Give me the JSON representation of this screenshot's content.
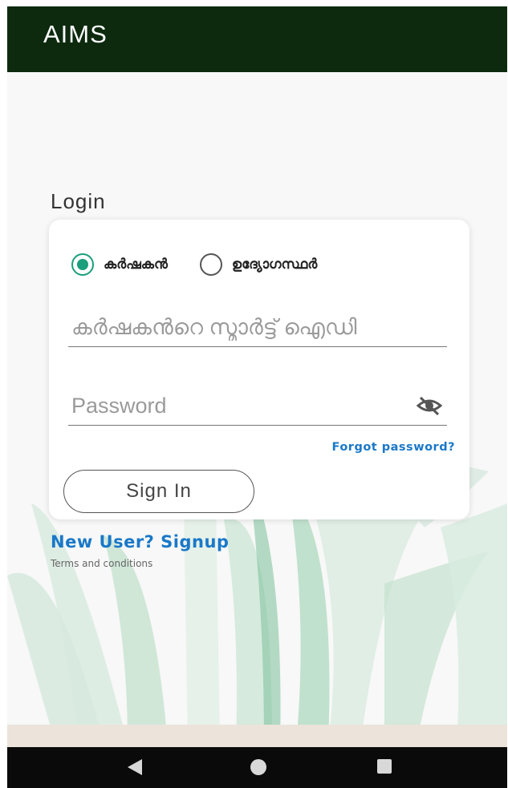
{
  "app": {
    "title": "AIMS"
  },
  "login": {
    "heading": "Login",
    "roles": [
      {
        "label": "കർഷകൻ",
        "selected": true
      },
      {
        "label": "ഉദ്യോഗസ്ഥർ",
        "selected": false
      }
    ],
    "smart_id": {
      "placeholder": "കർഷകൻറെ സ്മാർട്ട് ഐഡി",
      "value": ""
    },
    "password": {
      "placeholder": "Password",
      "value": ""
    },
    "forgot_label": "Forgot password?",
    "signin_label": "Sign In",
    "signup_label": "New User? Signup",
    "terms_label": "Terms and conditions"
  },
  "icons": {
    "radio_checked": "radio-checked-icon",
    "radio_unchecked": "radio-unchecked-icon",
    "password_toggle": "eye-slash-icon",
    "nav_back": "back-triangle-icon",
    "nav_home": "home-circle-icon",
    "nav_recents": "recents-square-icon"
  },
  "colors": {
    "appbar": "#0d2a0e",
    "accent": "#1a9e7c",
    "link": "#1a78c8",
    "navbar": "#0a0a0a"
  }
}
